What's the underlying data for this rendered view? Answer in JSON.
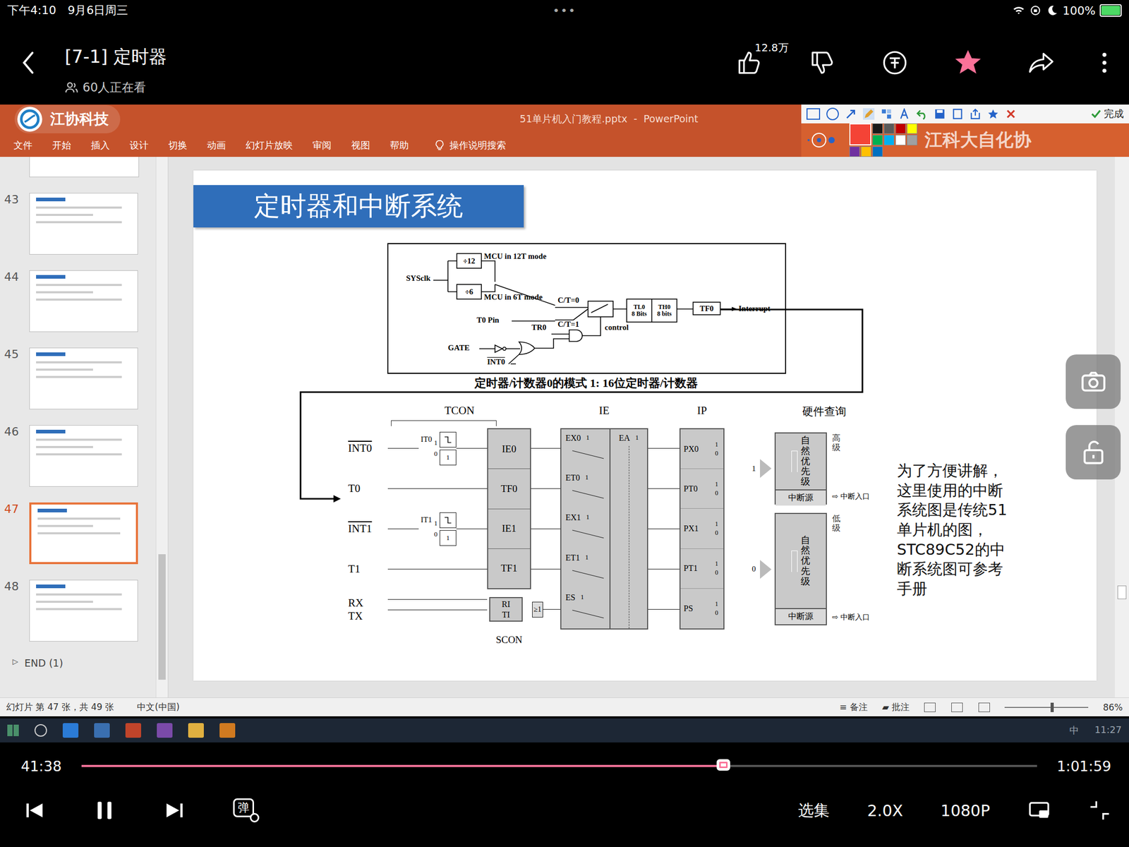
{
  "status_bar": {
    "time": "下午4:10",
    "date": "9月6日周三",
    "dots": "•••",
    "battery": "100%",
    "battery_level": 1
  },
  "header": {
    "title": "[7-1] 定时器",
    "viewers": "60人正在看",
    "likes": "12.8万",
    "liked": false,
    "disliked": false,
    "starred": true
  },
  "ppt": {
    "app_name": "江协科技",
    "file_title": "51单片机入门教程.pptx  -  PowerPoint",
    "tabs": [
      "文件",
      "开始",
      "插入",
      "设计",
      "切换",
      "动画",
      "幻灯片放映",
      "审阅",
      "视图",
      "帮助"
    ],
    "search": "操作说明搜索",
    "pen_done": "完成",
    "watermark": "江科大自化协",
    "pen_colors": [
      {
        "color": "#f44336",
        "selected": true
      },
      {
        "color": "#1a1a1a",
        "selected": false
      },
      {
        "color": "#5a5a5a",
        "selected": false
      },
      {
        "color": "#c00000",
        "selected": false
      },
      {
        "color": "#ffff00",
        "selected": false
      },
      {
        "color": "#00b050",
        "selected": false
      },
      {
        "color": "#00b0f0",
        "selected": false
      },
      {
        "color": "#ffffff",
        "selected": false
      },
      {
        "color": "#a0a0a0",
        "selected": false
      },
      {
        "color": "#7030a0",
        "selected": false
      },
      {
        "color": "#ffc000",
        "selected": false
      },
      {
        "color": "#0070c0",
        "selected": false
      }
    ],
    "slides": [
      {
        "number": "43",
        "selected": false
      },
      {
        "number": "44",
        "selected": false
      },
      {
        "number": "45",
        "selected": false
      },
      {
        "number": "46",
        "selected": false
      },
      {
        "number": "47",
        "selected": true
      },
      {
        "number": "48",
        "selected": false
      }
    ],
    "end_label": "END (1)",
    "status": {
      "slide_info": "幻灯片 第 47 张，共 49 张",
      "language": "中文(中国)",
      "notes": "备注",
      "comments": "批注",
      "zoom": "86%",
      "zoom_level": 0.55
    },
    "taskbar": {
      "ime": "中",
      "time": "11:27"
    }
  },
  "slide": {
    "title": "定时器和中断系统",
    "note": "为了方便讲解，这里使用的中断系统图是传统51单片机的图，STC89C52的中断系统图可参考手册",
    "timer_diagram": {
      "sysclk": "SYSclk",
      "div12": "÷12",
      "mode12": "MCU in 12T mode",
      "div6": "÷6",
      "mode6": "MCU in 6T mode",
      "t0_pin": "T0 Pin",
      "ct0": "C/T=0",
      "ct1": "C/T=1",
      "tr0": "TR0",
      "gate": "GATE",
      "int0": "INT0",
      "int0_overline": true,
      "control": "control",
      "tl0": "TL0",
      "tl0_bits": "8 Bits",
      "th0": "TH0",
      "th0_bits": "8 bits",
      "tf0": "TF0",
      "interrupt": "Interrupt",
      "caption": "定时器/计数器0的模式 1: 16位定时器/计数器"
    },
    "interrupt_diagram": {
      "headers": {
        "tcon": "TCON",
        "ie": "IE",
        "ip": "IP",
        "hardware": "硬件查询"
      },
      "marks": {
        "one": "1",
        "zero": "0"
      },
      "sources": [
        {
          "label": "INT0",
          "second_label": "",
          "overline": true,
          "kind": "external",
          "trigger": "IT0",
          "flag": "IE0",
          "second_flag": "",
          "gate": "",
          "enable": "EX0",
          "priority": "PX0"
        },
        {
          "label": "T0",
          "second_label": "",
          "overline": false,
          "kind": "timer",
          "trigger": "",
          "flag": "TF0",
          "second_flag": "",
          "gate": "",
          "enable": "ET0",
          "priority": "PT0"
        },
        {
          "label": "INT1",
          "second_label": "",
          "overline": true,
          "kind": "external",
          "trigger": "IT1",
          "flag": "IE1",
          "second_flag": "",
          "gate": "",
          "enable": "EX1",
          "priority": "PX1"
        },
        {
          "label": "T1",
          "second_label": "",
          "overline": false,
          "kind": "timer",
          "trigger": "",
          "flag": "TF1",
          "second_flag": "",
          "gate": "",
          "enable": "ET1",
          "priority": "PT1"
        },
        {
          "label": "RX",
          "second_label": "TX",
          "overline": false,
          "kind": "serial",
          "trigger": "",
          "flag": "RI",
          "second_flag": "TI",
          "gate": "≥1",
          "enable": "ES",
          "priority": "PS"
        }
      ],
      "enable_all": "EA",
      "serial_register": "SCON",
      "hardware": [
        {
          "priority_label": "自然优先级",
          "source": "中断源",
          "level": "高级",
          "entry": "中断入口",
          "bit": "1"
        },
        {
          "priority_label": "自然优先级",
          "source": "中断源",
          "level": "低级",
          "entry": "中断入口",
          "bit": "0"
        }
      ]
    }
  },
  "controls": {
    "current": "41:38",
    "duration": "1:01:59",
    "level": 0.672,
    "playing": true,
    "danmaku": "弹",
    "episodes": "选集",
    "speed": "2.0X",
    "quality": "1080P"
  }
}
